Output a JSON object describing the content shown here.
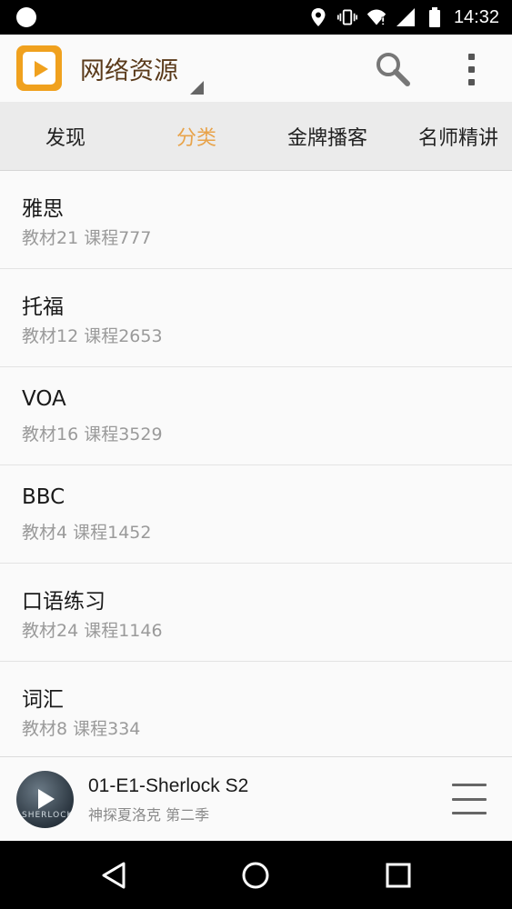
{
  "status_bar": {
    "time": "14:32",
    "icons": [
      "notification-dot-icon",
      "location-icon",
      "vibrate-icon",
      "wifi-icon",
      "signal-icon",
      "battery-icon"
    ]
  },
  "app_bar": {
    "title": "网络资源",
    "logo_icon": "play-logo-icon",
    "actions": [
      "search-icon",
      "more-vert-icon"
    ],
    "accent_color": "#f0a11e"
  },
  "tabs": [
    {
      "label": "发现",
      "active": false
    },
    {
      "label": "分类",
      "active": true
    },
    {
      "label": "金牌播客",
      "active": false
    },
    {
      "label": "名师精讲",
      "active": false
    }
  ],
  "tab_active_color": "#e8a34a",
  "categories": [
    {
      "title": "雅思",
      "subtitle": "教材21 课程777"
    },
    {
      "title": "托福",
      "subtitle": "教材12 课程2653"
    },
    {
      "title": "VOA",
      "subtitle": "教材16 课程3529"
    },
    {
      "title": "BBC",
      "subtitle": "教材4 课程1452"
    },
    {
      "title": "口语练习",
      "subtitle": "教材24 课程1146"
    },
    {
      "title": "词汇",
      "subtitle": "教材8 课程334"
    }
  ],
  "player": {
    "track_title": "01-E1-Sherlock S2",
    "track_subtitle": "神探夏洛克 第二季",
    "cover_text": "SHERLOCK",
    "icons": [
      "play-icon",
      "playlist-icon"
    ]
  },
  "nav_bar": {
    "icons": [
      "back-icon",
      "home-icon",
      "recents-icon"
    ]
  }
}
